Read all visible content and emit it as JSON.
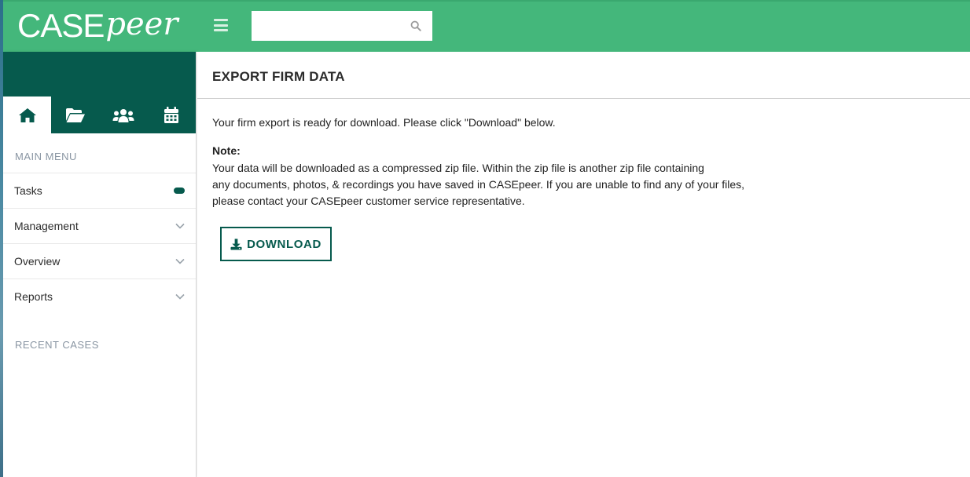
{
  "brand": {
    "logo_case": "CASE",
    "logo_peer": "peer",
    "green": "#44b77b",
    "dark_green": "#065a4d"
  },
  "header": {
    "search_value": "",
    "menu_icon": "hamburger-icon",
    "search_icon": "search-icon"
  },
  "sidebar": {
    "tabs": [
      {
        "icon": "home-icon",
        "active": true
      },
      {
        "icon": "folder-open-icon",
        "active": false
      },
      {
        "icon": "users-icon",
        "active": false
      },
      {
        "icon": "calendar-icon",
        "active": false
      }
    ],
    "main_menu_label": "MAIN MENU",
    "items": [
      {
        "label": "Tasks",
        "indicator": "pill"
      },
      {
        "label": "Management",
        "indicator": "chevron-down-icon"
      },
      {
        "label": "Overview",
        "indicator": "chevron-down-icon"
      },
      {
        "label": "Reports",
        "indicator": "chevron-down-icon"
      }
    ],
    "recent_label": "RECENT CASES"
  },
  "main": {
    "title": "EXPORT FIRM DATA",
    "ready_message": "Your firm export is ready for download. Please click \"Download\" below.",
    "note_title": "Note:",
    "note_lines": [
      "Your data will be downloaded as a compressed zip file. Within the zip file is another zip file containing",
      "any documents, photos, & recordings you have saved in CASEpeer. If you are unable to find any of your files,",
      "please contact your CASEpeer customer service representative."
    ],
    "download_label": "DOWNLOAD",
    "download_icon": "download-icon"
  }
}
